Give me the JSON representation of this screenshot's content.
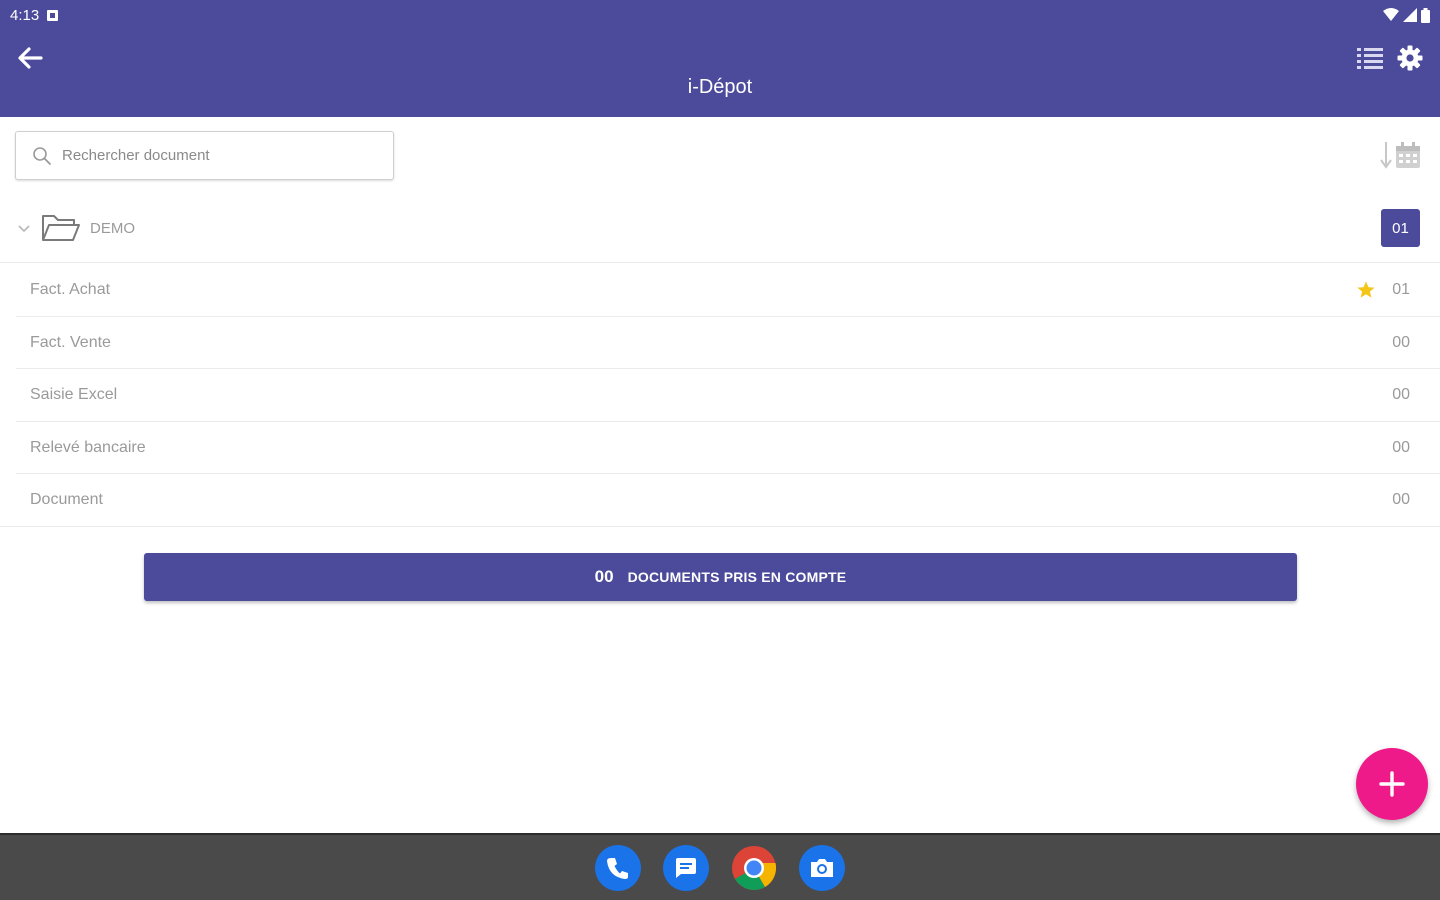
{
  "status_bar": {
    "time": "4:13"
  },
  "app_bar": {
    "title": "i-Dépot"
  },
  "search": {
    "placeholder": "Rechercher document"
  },
  "folder": {
    "name": "DEMO",
    "count": "01"
  },
  "items": [
    {
      "label": "Fact. Achat",
      "count": "01",
      "starred": true
    },
    {
      "label": "Fact. Vente",
      "count": "00",
      "starred": false
    },
    {
      "label": "Saisie Excel",
      "count": "00",
      "starred": false
    },
    {
      "label": "Relevé bancaire",
      "count": "00",
      "starred": false
    },
    {
      "label": "Document",
      "count": "00",
      "starred": false
    }
  ],
  "summary": {
    "count": "00",
    "text": "DOCUMENTS PRIS EN COMPTE"
  },
  "icons": {
    "back": "arrow-left-icon",
    "list": "list-icon",
    "settings": "gear-icon",
    "search": "search-icon",
    "sort_calendar": "sort-calendar-icon",
    "chevron": "chevron-down-icon",
    "folder": "folder-open-icon",
    "star": "star-icon",
    "fab": "plus-icon",
    "dock": [
      "phone-icon",
      "messages-icon",
      "chrome-icon",
      "camera-icon"
    ]
  },
  "colors": {
    "primary": "#4c4a9a",
    "accent": "#ee1a8a",
    "star": "#f5c518",
    "text_muted": "#9a9a9a"
  }
}
